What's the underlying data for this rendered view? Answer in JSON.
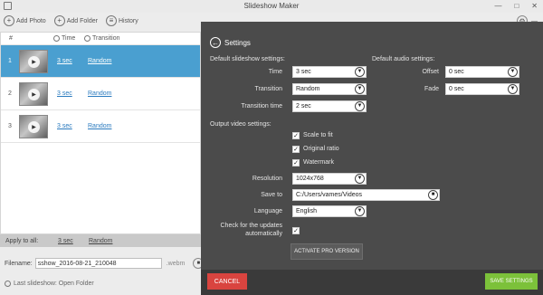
{
  "window": {
    "title": "Slideshow Maker"
  },
  "toolbar": {
    "add_photo": "Add Photo",
    "add_folder": "Add Folder",
    "history": "History",
    "user_name": "—"
  },
  "list": {
    "headers": {
      "num": "#",
      "time": "Time",
      "transition": "Transition"
    },
    "rows": [
      {
        "num": "1",
        "time": "3 sec",
        "transition": "Random"
      },
      {
        "num": "2",
        "time": "3 sec",
        "transition": "Random"
      },
      {
        "num": "3",
        "time": "3 sec",
        "transition": "Random"
      }
    ],
    "apply_label": "Apply to all:",
    "apply_time": "3 sec",
    "apply_transition": "Random"
  },
  "file": {
    "label": "Filename:",
    "value": "sshow_2016-08-21_210048",
    "ext": ".webm"
  },
  "last_show": "Last slideshow: Open Folder",
  "settings": {
    "header": "Settings",
    "slideshow_section": "Default slideshow settings:",
    "audio_section": "Default audio settings:",
    "time_label": "Time",
    "time_value": "3 sec",
    "transition_label": "Transition",
    "transition_value": "Random",
    "transition_time_label": "Transition time",
    "transition_time_value": "2 sec",
    "offset_label": "Offset",
    "offset_value": "0 sec",
    "fade_label": "Fade",
    "fade_value": "0 sec",
    "output_section": "Output video settings:",
    "scale_label": "Scale to fit",
    "ratio_label": "Original ratio",
    "watermark_label": "Watermark",
    "resolution_label": "Resolution",
    "resolution_value": "1024x768",
    "save_to_label": "Save to",
    "save_to_value": "C:/Users/vames/Videos",
    "language_label": "Language",
    "language_value": "English",
    "updates_label_1": "Check for the updates",
    "updates_label_2": "automatically",
    "activate_label": "ACTIVATE PRO VERSION",
    "cancel_label": "CANCEL",
    "save_label": "SAVE SETTINGS"
  },
  "colors": {
    "selected_row": "#4a9fd0",
    "panel_bg": "#4b4b4b",
    "footer_bg": "#3a3a3a",
    "cancel": "#d9443f",
    "save": "#7cc13a"
  }
}
